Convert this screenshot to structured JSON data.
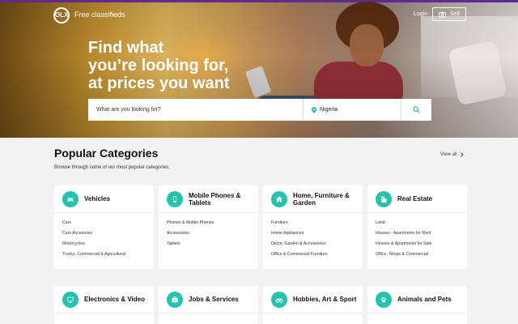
{
  "header": {
    "logo_text": "OLX",
    "tagline": "Free classifieds",
    "login_label": "Login",
    "sell_label": "Sell"
  },
  "hero": {
    "title_lines": [
      "Find what",
      "you’re looking for,",
      "at prices you want"
    ],
    "search_placeholder": "What are you looking for?",
    "location_value": "Nigeria"
  },
  "categories_section": {
    "title": "Popular Categories",
    "subtitle": "Browse through some of our most popular categories.",
    "view_all_label": "View all"
  },
  "categories": [
    {
      "title": "Vehicles",
      "icon": "car-icon",
      "items": [
        "Cars",
        "Cars Accesories",
        "Motorcycles",
        "Trucks, Commercial & Agricultural"
      ]
    },
    {
      "title": "Mobile Phones & Tablets",
      "icon": "mobile-phone-icon",
      "items": [
        "Phones & Mobile Phones",
        "Accessories",
        "Tablets"
      ]
    },
    {
      "title": "Home, Furniture & Garden",
      "icon": "house-icon",
      "items": [
        "Furniture",
        "Home Appliances",
        "Decor, Garden & Accessories",
        "Office & Commercial Furniture"
      ]
    },
    {
      "title": "Real Estate",
      "icon": "building-icon",
      "items": [
        "Land",
        "Houses - Apartments for Rent",
        "Houses & Apartments for Sale",
        "Office, Shops & Commercial"
      ]
    },
    {
      "title": "Electronics & Video",
      "icon": "monitor-icon",
      "items": []
    },
    {
      "title": "Jobs & Services",
      "icon": "briefcase-icon",
      "items": []
    },
    {
      "title": "Hobbies, Art & Sport",
      "icon": "bicycle-icon",
      "items": []
    },
    {
      "title": "Animals and Pets",
      "icon": "paw-icon",
      "items": []
    }
  ],
  "colors": {
    "accent": "#23c4ae",
    "top_bar": "#6b2e9e",
    "page_background": "#f2f2f2"
  }
}
